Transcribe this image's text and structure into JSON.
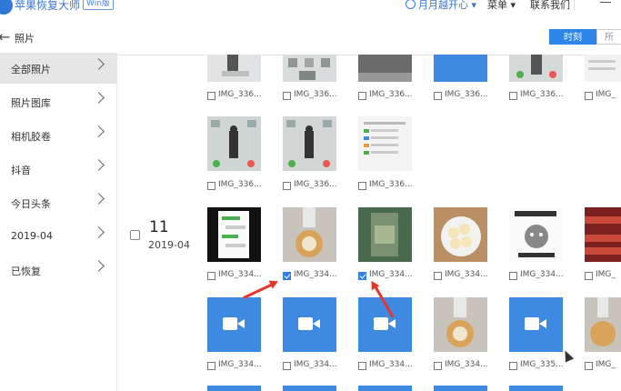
{
  "titlebar": {
    "app_name": "苹果恢复大师",
    "edition_badge": "Win版",
    "user_label": "月月越开心",
    "menu_label": "菜单",
    "contact_label": "联系我们"
  },
  "header": {
    "title": "照片",
    "view_time": "时刻",
    "view_all": "所"
  },
  "sidebar": {
    "items": [
      {
        "label": "全部照片",
        "active": true
      },
      {
        "label": "照片图库"
      },
      {
        "label": "相机胶卷"
      },
      {
        "label": "抖音"
      },
      {
        "label": "今日头条"
      },
      {
        "label": "2019-04"
      },
      {
        "label": "已恢复"
      }
    ]
  },
  "group": {
    "day": "11",
    "month": "2019-04"
  },
  "photos": {
    "row1": [
      {
        "caption": "IMG_336..."
      },
      {
        "caption": "IMG_336..."
      },
      {
        "caption": "IMG_336..."
      },
      {
        "caption": "IMG_336..."
      },
      {
        "caption": "IMG_336..."
      },
      {
        "caption": "IMG_"
      }
    ],
    "row2": [
      {
        "caption": "IMG_336..."
      },
      {
        "caption": "IMG_336..."
      },
      {
        "caption": "IMG_336..."
      }
    ],
    "row3": [
      {
        "caption": "IMG_334...",
        "checked": false
      },
      {
        "caption": "IMG_334...",
        "checked": true
      },
      {
        "caption": "IMG_334...",
        "checked": true
      },
      {
        "caption": "IMG_334...",
        "checked": false
      },
      {
        "caption": "IMG_334...",
        "checked": false
      },
      {
        "caption": "IMG_",
        "checked": false
      }
    ],
    "row4": [
      {
        "caption": "IMG_334..."
      },
      {
        "caption": "IMG_334..."
      },
      {
        "caption": "IMG_334..."
      },
      {
        "caption": "IMG_334..."
      },
      {
        "caption": "IMG_335..."
      },
      {
        "caption": "IMG_"
      }
    ]
  },
  "colors": {
    "accent": "#2f86e8",
    "video_tile": "#3d8ae0",
    "annotation_arrow": "#e8352b"
  }
}
